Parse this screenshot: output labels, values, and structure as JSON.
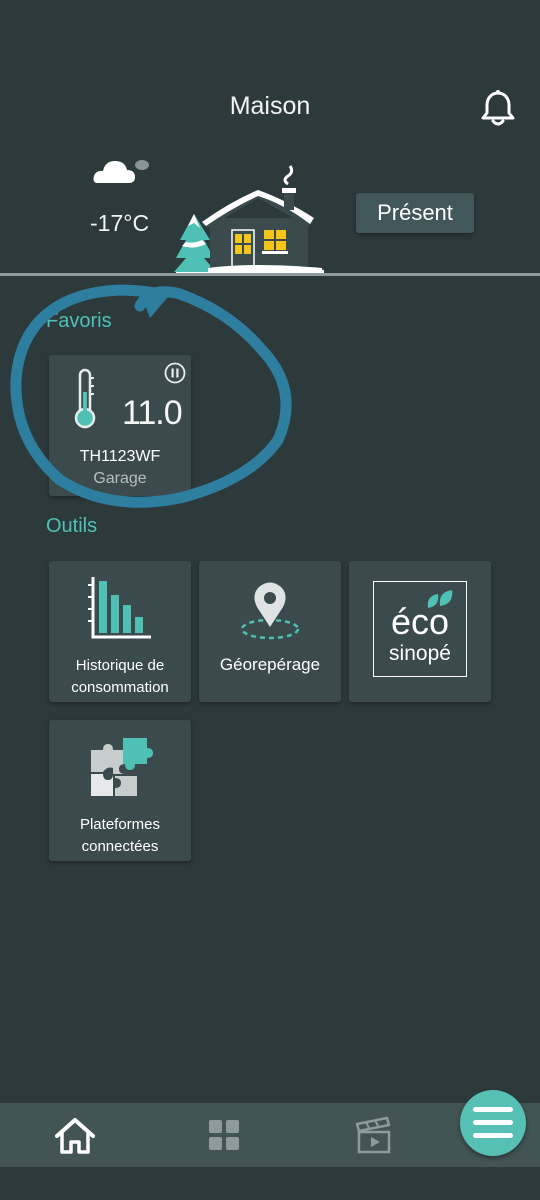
{
  "header": {
    "title": "Maison"
  },
  "weather": {
    "temperature": "-17°C"
  },
  "mode": {
    "label": "Présent"
  },
  "sections": {
    "favorites": "Favoris",
    "tools": "Outils"
  },
  "favorite_device": {
    "setpoint": "11.0",
    "name": "TH1123WF",
    "room": "Garage"
  },
  "tools": [
    {
      "label": "Historique de consommation",
      "line1": "Historique de",
      "line2": "consommation"
    },
    {
      "label": "Géorepérage"
    },
    {
      "label": "éco sinopé",
      "logo_line1": "éco",
      "logo_line2": "sinopé"
    },
    {
      "label": "Plateformes connectées",
      "line1": "Plateformes",
      "line2": "connectées"
    }
  ],
  "colors": {
    "background": "#2d3a3b",
    "card": "#3b4a4c",
    "accent": "#4fc0b4",
    "annotation": "#2e7ea0"
  },
  "icons": {
    "bell": "bell-icon",
    "weather": "cloud-icon",
    "thermometer": "thermometer-icon",
    "pause": "pause-icon",
    "chart": "bar-chart-icon",
    "geofence": "map-pin-icon",
    "puzzle": "puzzle-icon",
    "home": "home-icon",
    "grid": "grid-icon",
    "scenes": "clapperboard-icon",
    "menu": "menu-icon"
  }
}
